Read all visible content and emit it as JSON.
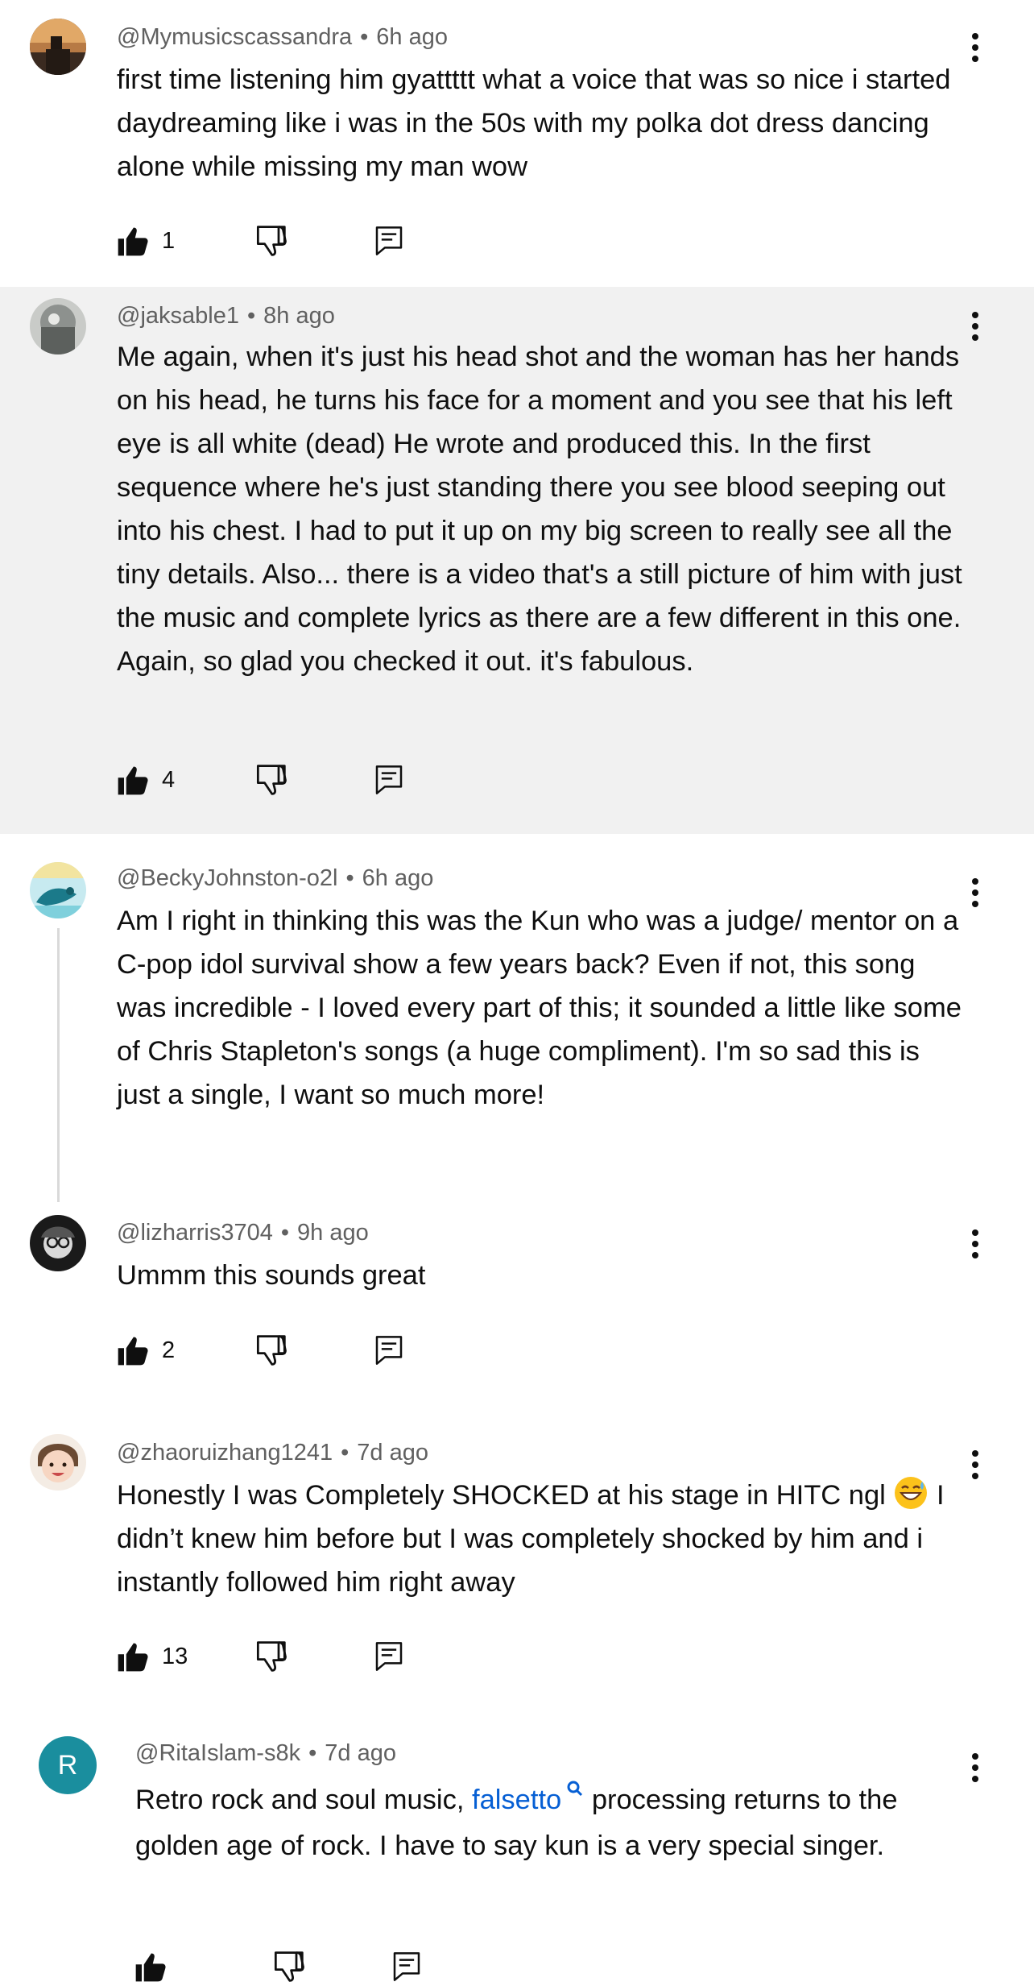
{
  "comments": [
    {
      "author": "@Mymusicscassandra",
      "time": "6h ago",
      "text": "first time listening him gyattttt what a voice that was so nice i started daydreaming like i was in the 50s with my polka dot dress dancing alone while missing my man wow",
      "likes": "1"
    },
    {
      "author": "@jaksable1",
      "time": "8h ago",
      "text": "Me again, when it's just his head shot and the woman has her hands on his head, he turns his face for a moment and you see that his left eye is all white (dead) He wrote and produced this. In the first sequence where he's just standing there you see blood seeping out into his chest. I had to put it up on my big screen to really see all the tiny details. Also... there is a video that's a still picture of him with just the music and complete lyrics as there are a few different in this one. Again, so glad you checked it out. it's fabulous.",
      "likes": "4"
    },
    {
      "author": "@BeckyJohnston-o2l",
      "time": "6h ago",
      "text": "Am I right in thinking this was the Kun who was a judge/ mentor on a C-pop idol survival show a few years back? Even if not, this song was incredible - I loved every part of this; it sounded a little like some of Chris Stapleton's songs (a huge compliment). I'm so sad this is just a single, I want so much more!"
    },
    {
      "author": "@lizharris3704",
      "time": "9h ago",
      "text": "Ummm this sounds great",
      "likes": "2"
    },
    {
      "author": "@zhaoruizhang1241",
      "time": "7d ago",
      "text_before_emoji": "Honestly I was Completely SHOCKED at his stage in HITC ngl ",
      "text_after_emoji": " I didn’t knew him before but I was completely shocked by him and i instantly followed him right away",
      "likes": "13"
    },
    {
      "author": "@RitaIslam-s8k",
      "time": "7d ago",
      "avatar_letter": "R",
      "text_before_link": "Retro rock and soul music, ",
      "link_text": "falsetto",
      "text_after_link": " processing returns to the golden age of rock. I have to say kun is a very special singer."
    }
  ],
  "separator": "•",
  "icons": {
    "like": "thumbs-up-icon",
    "dislike": "thumbs-down-icon",
    "reply": "reply-icon",
    "more": "more-vert-icon",
    "search": "search-icon",
    "emoji": "grinning-sweat-emoji"
  },
  "colors": {
    "highlight_bg": "#f1f1f1",
    "meta_text": "#606060",
    "link": "#065fd4",
    "avatar_R": "#1a8e9e"
  }
}
